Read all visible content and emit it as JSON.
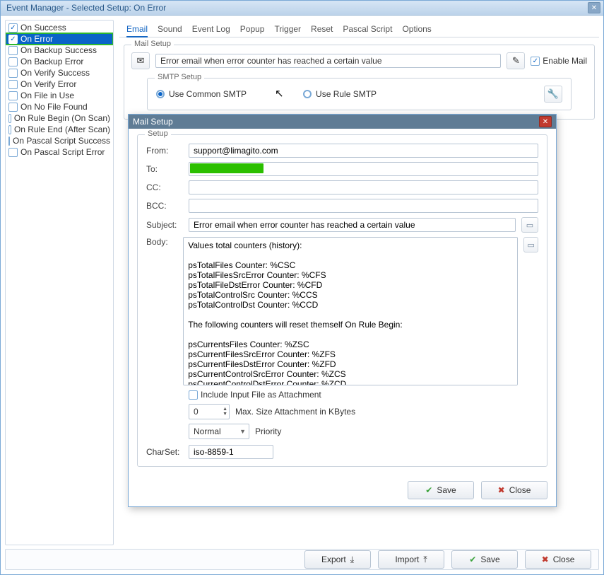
{
  "window": {
    "title": "Event Manager - Selected Setup: On Error"
  },
  "events": [
    {
      "label": "On Success",
      "checked": true,
      "selected": false
    },
    {
      "label": "On Error",
      "checked": true,
      "selected": true,
      "highlight": true
    },
    {
      "label": "On Backup Success",
      "checked": false,
      "selected": false
    },
    {
      "label": "On Backup Error",
      "checked": false,
      "selected": false
    },
    {
      "label": "On Verify Success",
      "checked": false,
      "selected": false
    },
    {
      "label": "On Verify Error",
      "checked": false,
      "selected": false
    },
    {
      "label": "On File in Use",
      "checked": false,
      "selected": false
    },
    {
      "label": "On No File Found",
      "checked": false,
      "selected": false
    },
    {
      "label": "On Rule Begin (On Scan)",
      "checked": false,
      "selected": false
    },
    {
      "label": "On Rule End (After Scan)",
      "checked": false,
      "selected": false
    },
    {
      "label": "On Pascal Script Success",
      "checked": false,
      "selected": false
    },
    {
      "label": "On Pascal Script Error",
      "checked": false,
      "selected": false
    }
  ],
  "tabs": [
    "Email",
    "Sound",
    "Event Log",
    "Popup",
    "Trigger",
    "Reset",
    "Pascal Script",
    "Options"
  ],
  "active_tab": "Email",
  "mail_setup": {
    "legend": "Mail Setup",
    "description": "Error email when error counter has reached a certain value",
    "enable_mail_label": "Enable Mail",
    "enable_mail_checked": true,
    "smtp": {
      "legend": "SMTP Setup",
      "common_label": "Use Common SMTP",
      "rule_label": "Use Rule SMTP",
      "selected": "common"
    }
  },
  "dialog": {
    "title": "Mail Setup",
    "setup_legend": "Setup",
    "from_label": "From:",
    "from_value": "support@limagito.com",
    "to_label": "To:",
    "to_value": "",
    "cc_label": "CC:",
    "cc_value": "",
    "bcc_label": "BCC:",
    "bcc_value": "",
    "subject_label": "Subject:",
    "subject_value": "Error email when error counter has reached a certain value",
    "body_label": "Body:",
    "body_value": "Values total counters (history):\n\npsTotalFiles Counter: %CSC\npsTotalFilesSrcError Counter: %CFS\npsTotalFileDstError Counter: %CFD\npsTotalControlSrc Counter: %CCS\npsTotalControlDst Counter: %CCD\n\nThe following counters will reset themself On Rule Begin:\n\npsCurrentsFiles Counter: %ZSC\npsCurrentFilesSrcError Counter: %ZFS\npsCurrentFilesDstError Counter: %ZFD\npsCurrentControlSrcError Counter: %ZCS\npsCurrentControlDstError Counter: %ZCD\n",
    "include_attach_label": "Include Input File as Attachment",
    "include_attach_checked": false,
    "max_size_value": "0",
    "max_size_label": "Max. Size Attachment in KBytes",
    "priority_value": "Normal",
    "priority_label": "Priority",
    "charset_label": "CharSet:",
    "charset_value": "iso-8859-1",
    "save_label": "Save",
    "close_label": "Close"
  },
  "bottom": {
    "export_label": "Export",
    "import_label": "Import",
    "save_label": "Save",
    "close_label": "Close"
  }
}
